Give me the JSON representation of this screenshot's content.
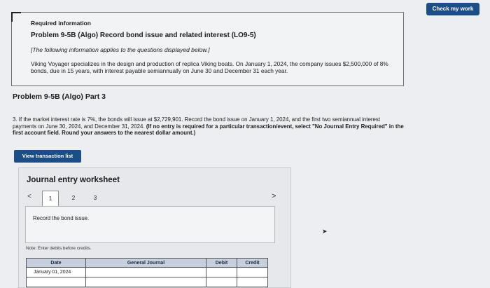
{
  "header": {
    "check_work_label": "Check my work"
  },
  "info": {
    "required_label": "Required information",
    "problem_title": "Problem 9-5B (Algo) Record bond issue and related interest (LO9-5)",
    "following_info": "[The following information applies to the questions displayed below.]",
    "description": "Viking Voyager specializes in the design and production of replica Viking boats. On January 1, 2024, the company issues $2,500,000 of 8% bonds, due in 15 years, with interest payable semiannually on June 30 and December 31 each year."
  },
  "part": {
    "title": "Problem 9-5B (Algo) Part 3",
    "question_text": "3. If the market interest rate is 7%, the bonds will issue at $2,729,901. Record the bond issue on January 1, 2024, and the first two semiannual interest payments on June 30, 2024, and December 31, 2024.",
    "question_bold": "(If no entry is required for a particular transaction/event, select \"No Journal Entry Required\" in the first account field. Round your answers to the nearest dollar amount.)",
    "view_transaction_label": "View transaction list"
  },
  "worksheet": {
    "title": "Journal entry worksheet",
    "prev_arrow": "<",
    "next_arrow": ">",
    "tabs": [
      "1",
      "2",
      "3"
    ],
    "instruction": "Record the bond issue.",
    "note": "Note: Enter debits before credits.",
    "columns": {
      "date": "Date",
      "account": "General Journal",
      "debit": "Debit",
      "credit": "Credit"
    },
    "rows": [
      {
        "date": "January 01, 2024",
        "account": "",
        "debit": "",
        "credit": ""
      },
      {
        "date": "",
        "account": "",
        "debit": "",
        "credit": ""
      }
    ]
  }
}
